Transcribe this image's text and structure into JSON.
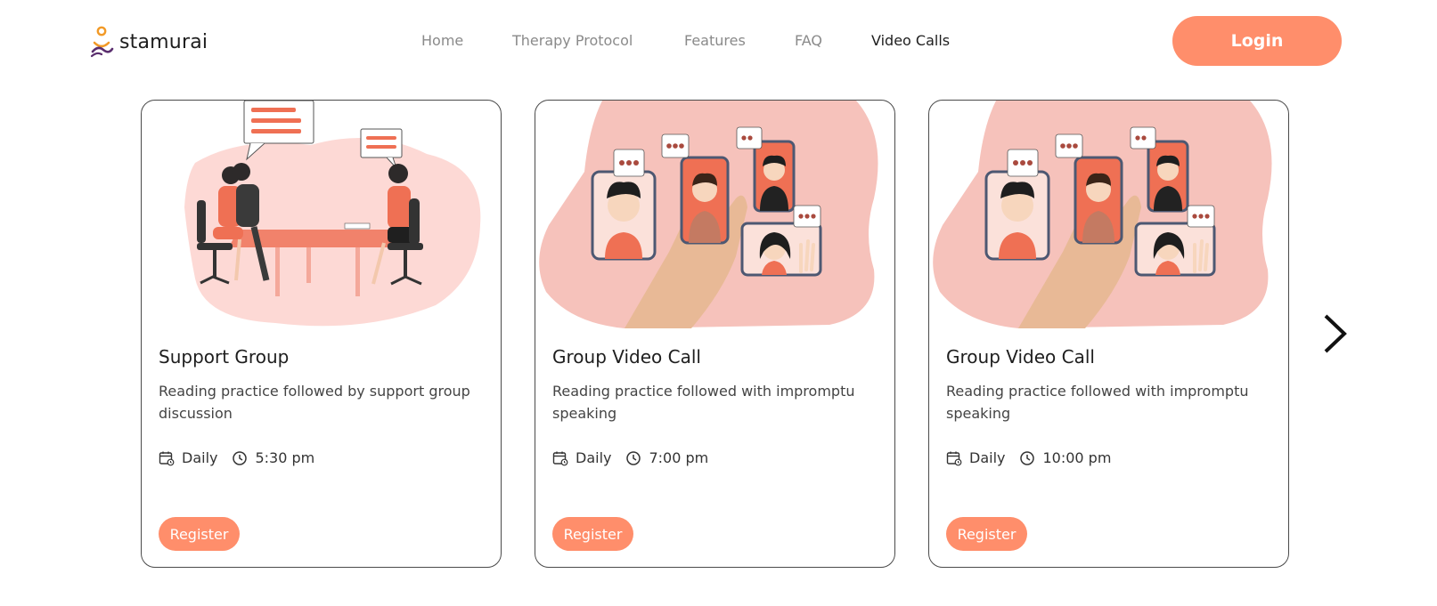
{
  "brand": {
    "name": "stamurai"
  },
  "nav": {
    "items": [
      {
        "label": "Home",
        "active": false
      },
      {
        "label": "Therapy Protocol",
        "active": false
      },
      {
        "label": "Features",
        "active": false
      },
      {
        "label": "FAQ",
        "active": false
      },
      {
        "label": "Video Calls",
        "active": true
      }
    ],
    "login_label": "Login"
  },
  "cards": [
    {
      "illustration": "meeting-table-illustration",
      "title": "Support Group",
      "description": "Reading practice followed by support group discussion",
      "frequency": "Daily",
      "time": "5:30 pm",
      "register_label": "Register"
    },
    {
      "illustration": "group-video-call-illustration",
      "title": "Group Video Call",
      "description": "Reading practice followed with impromptu speaking",
      "frequency": "Daily",
      "time": "7:00 pm",
      "register_label": "Register"
    },
    {
      "illustration": "group-video-call-illustration",
      "title": "Group Video Call",
      "description": "Reading practice followed with impromptu speaking",
      "frequency": "Daily",
      "time": "10:00 pm",
      "register_label": "Register"
    }
  ],
  "carousel": {
    "next_icon": "chevron-right-icon"
  },
  "colors": {
    "accent": "#ff8e6b",
    "blob_light": "#fdd9d5",
    "blob_video": "#f6c2bb",
    "nav_inactive": "#8a8a8a",
    "text_dark": "#1e1e1e"
  }
}
